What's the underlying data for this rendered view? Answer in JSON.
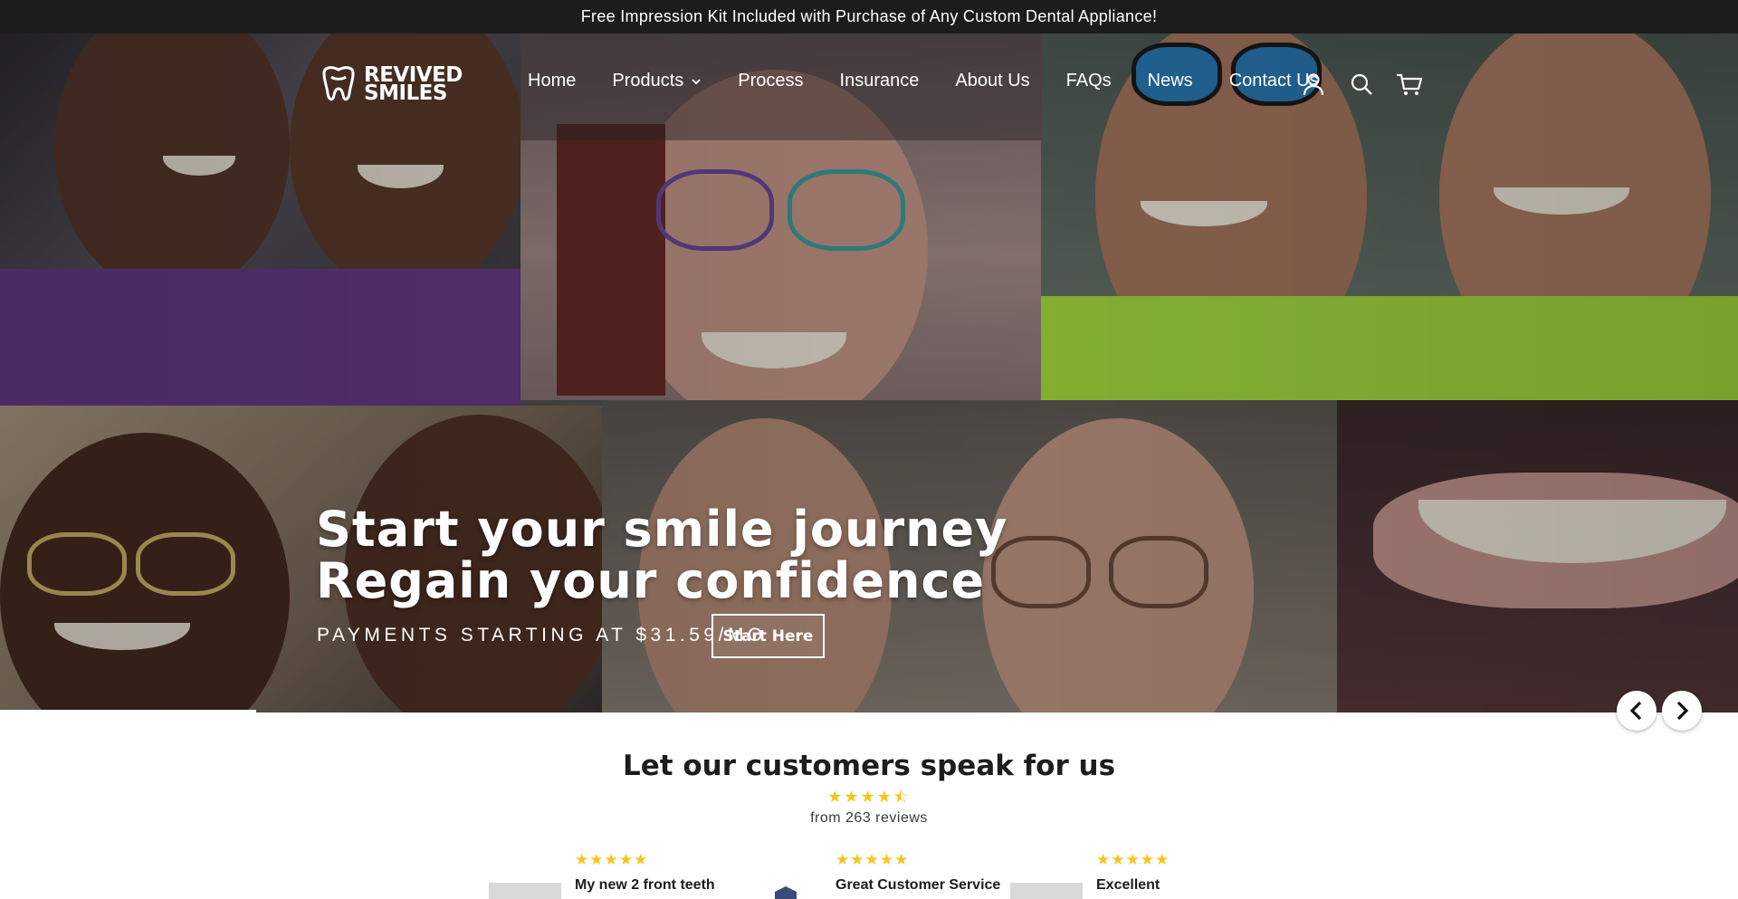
{
  "announcement": "Free Impression Kit Included with Purchase of Any Custom Dental Appliance!",
  "brand": {
    "line1": "REVIVED",
    "line2": "SMILES"
  },
  "nav": {
    "items": [
      "Home",
      "Products",
      "Process",
      "Insurance",
      "About Us",
      "FAQs",
      "News",
      "Contact Us"
    ]
  },
  "header_icons": [
    "account-icon",
    "search-icon",
    "cart-icon"
  ],
  "hero": {
    "title_line1": "Start your smile journey",
    "title_line2": "Regain your confidence",
    "subtitle": "PAYMENTS STARTING AT $31.59/MO",
    "cta": "Start Here"
  },
  "reviews": {
    "title": "Let our customers speak for us",
    "rating": 4.5,
    "stars": "★★★★⯪",
    "count_text": "from 263 reviews",
    "cards": [
      {
        "stars": "★★★★★",
        "title": "My new 2 front teeth"
      },
      {
        "stars": "★★★★★",
        "title": "Great Customer Service"
      },
      {
        "stars": "★★★★★",
        "title": "Excellent"
      }
    ]
  },
  "colors": {
    "announcement_bg": "#1c1c1c",
    "star": "#f5c518",
    "text": "#1c1d1d"
  }
}
